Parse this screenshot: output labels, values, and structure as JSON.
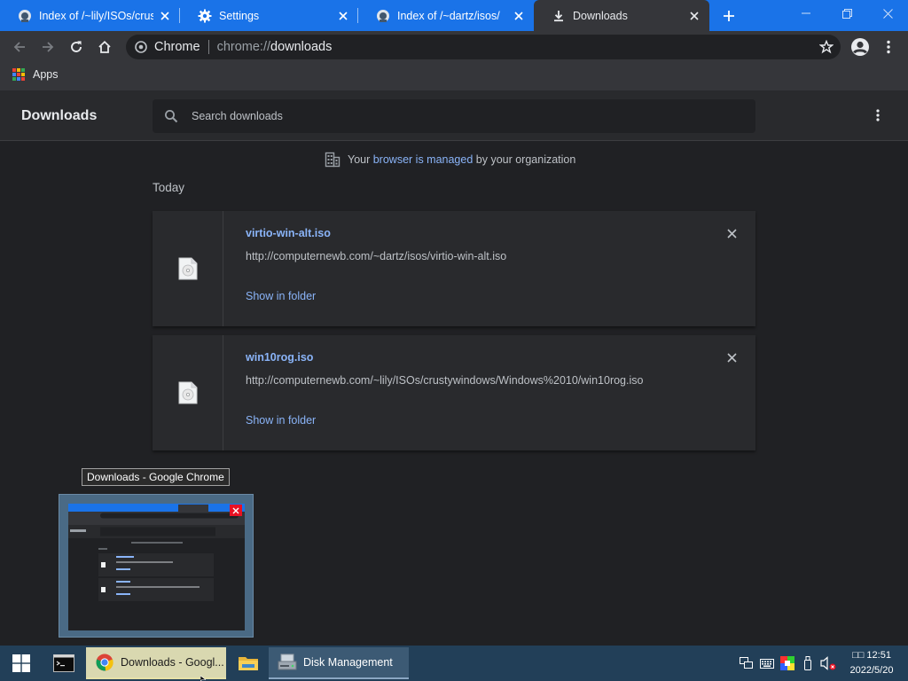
{
  "tabs": [
    {
      "title": "Index of /~lily/ISOs/crus",
      "icon": "server-icon",
      "active": false
    },
    {
      "title": "Settings",
      "icon": "gear-icon",
      "active": false
    },
    {
      "title": "Index of /~dartz/isos/",
      "icon": "server-icon",
      "active": false
    },
    {
      "title": "Downloads",
      "icon": "download-icon",
      "active": true
    }
  ],
  "toolbar": {
    "site_name": "Chrome",
    "url_scheme": "chrome://",
    "url_path": "downloads"
  },
  "bookmarks": {
    "apps_label": "Apps"
  },
  "downloads": {
    "title": "Downloads",
    "search_placeholder": "Search downloads",
    "managed_notice": {
      "before": "Your ",
      "link": "browser is managed",
      "after": " by your organization"
    },
    "section_label": "Today",
    "items": [
      {
        "filename": "virtio-win-alt.iso",
        "url": "http://computernewb.com/~dartz/isos/virtio-win-alt.iso",
        "action": "Show in folder"
      },
      {
        "filename": "win10rog.iso",
        "url": "http://computernewb.com/~lily/ISOs/crustywindows/Windows%2010/win10rog.iso",
        "action": "Show in folder"
      }
    ]
  },
  "tooltip": "Downloads - Google Chrome",
  "taskbar": {
    "apps": [
      {
        "label": "Downloads - Googl...",
        "icon": "chrome-icon",
        "active": true
      },
      {
        "label": "Disk Management",
        "icon": "disk-management-icon",
        "active": false
      }
    ],
    "clock_time": "□□ 12:51",
    "clock_date": "2022/5/20"
  },
  "colors": {
    "tab_strip": "#1a73e8",
    "toolbar": "#35363a",
    "page_background": "#202124",
    "card_background": "#292a2d",
    "link": "#8ab4f8",
    "taskbar": "#223f58"
  }
}
